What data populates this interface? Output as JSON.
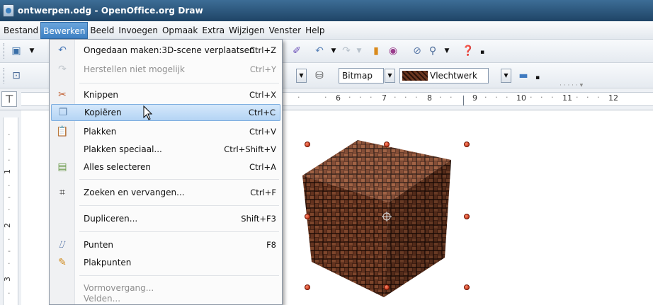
{
  "window": {
    "title": "ontwerpen.odg - OpenOffice.org Draw"
  },
  "menubar": {
    "items": [
      {
        "id": "bestand",
        "label": "Bestand"
      },
      {
        "id": "bewerken",
        "label": "Bewerken",
        "active": true
      },
      {
        "id": "beeld",
        "label": "Beeld"
      },
      {
        "id": "invoegen",
        "label": "Invoegen"
      },
      {
        "id": "opmaak",
        "label": "Opmaak"
      },
      {
        "id": "extra",
        "label": "Extra"
      },
      {
        "id": "wijzigen",
        "label": "Wijzigen"
      },
      {
        "id": "venster",
        "label": "Venster"
      },
      {
        "id": "help",
        "label": "Help"
      }
    ]
  },
  "toolbar2": {
    "area_style": "Bitmap",
    "area_fill": "Vlechtwerk"
  },
  "ruler": {
    "labels": [
      "6",
      "7",
      "8",
      "9",
      "10",
      "11",
      "12"
    ],
    "vlabels": [
      "1",
      "2",
      "3"
    ]
  },
  "edit_menu": {
    "items": [
      {
        "icon": "undo-icon",
        "label": "Ongedaan maken:3D-scene verplaatsen",
        "shortcut": "Ctrl+Z"
      },
      {
        "icon": "redo-icon",
        "label": "Herstellen niet mogelijk",
        "shortcut": "Ctrl+Y",
        "disabled": true
      },
      {
        "icon": "cut-icon",
        "label": "Knippen",
        "shortcut": "Ctrl+X"
      },
      {
        "icon": "copy-icon",
        "label": "Kopiëren",
        "shortcut": "Ctrl+C",
        "highlighted": true
      },
      {
        "icon": "paste-icon",
        "label": "Plakken",
        "shortcut": "Ctrl+V"
      },
      {
        "icon": "",
        "label": "Plakken speciaal...",
        "shortcut": "Ctrl+Shift+V"
      },
      {
        "icon": "select-all-icon",
        "label": "Alles selecteren",
        "shortcut": "Ctrl+A"
      },
      {
        "icon": "binoculars-icon",
        "label": "Zoeken en vervangen...",
        "shortcut": "Ctrl+F"
      },
      {
        "icon": "",
        "label": "Dupliceren...",
        "shortcut": "Shift+F3"
      },
      {
        "icon": "points-icon",
        "label": "Punten",
        "shortcut": "F8"
      },
      {
        "icon": "glue-points-icon",
        "label": "Plakpunten",
        "shortcut": ""
      },
      {
        "icon": "",
        "label": "Vormovergang...",
        "shortcut": "",
        "disabled": true
      },
      {
        "icon": "",
        "label": "Velden...",
        "shortcut": "",
        "disabled": true
      }
    ]
  },
  "colors": {
    "title_bg": "#2b5a82",
    "menu_active": "#3d80c3",
    "highlight": "#b4d4f4",
    "handle": "#b01b00"
  }
}
